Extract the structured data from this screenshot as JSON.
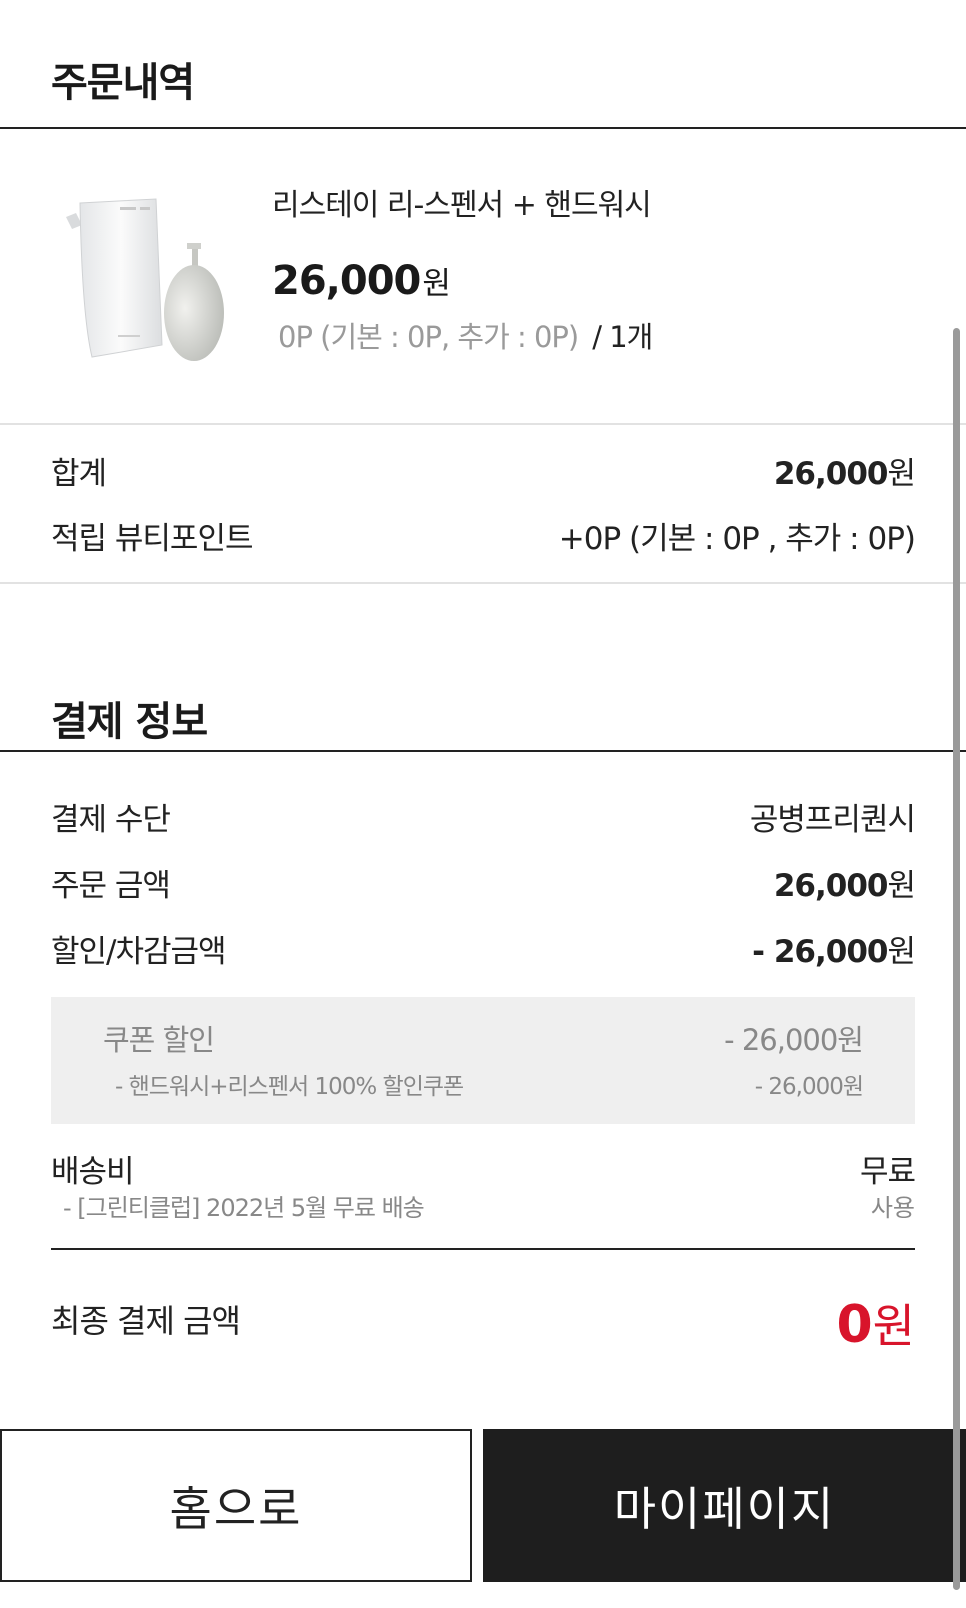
{
  "order": {
    "title": "주문내역",
    "product_name": "리스테이 리-스펜서 + 핸드워시",
    "price": "26,000",
    "price_unit": "원",
    "points": "0P (기본 : 0P, 추가 : 0P)",
    "quantity": "/ 1개"
  },
  "summary": {
    "total_label": "합계",
    "total_value": "26,000",
    "total_unit": "원",
    "points_label": "적립 뷰티포인트",
    "points_value": "+0P (기본 : 0P , 추가 : 0P)"
  },
  "payment": {
    "title": "결제 정보",
    "method_label": "결제 수단",
    "method_value": "공병프리퀀시",
    "order_amount_label": "주문 금액",
    "order_amount_value": "26,000",
    "order_amount_unit": "원",
    "discount_label": "할인/차감금액",
    "discount_value": "- 26,000",
    "discount_unit": "원",
    "coupon_label": "쿠폰 할인",
    "coupon_value": "- 26,000원",
    "coupon_detail": "- 핸드워시+리스펜서 100% 할인쿠폰",
    "coupon_detail_value": "- 26,000원",
    "shipping_label": "배송비",
    "shipping_value": "무료",
    "shipping_detail": "- [그린티클럽] 2022년 5월 무료 배송",
    "shipping_detail_value": "사용",
    "final_label": "최종 결제 금액",
    "final_value": "0",
    "final_unit": "원"
  },
  "buttons": {
    "home": "홈으로",
    "mypage": "마이페이지"
  }
}
